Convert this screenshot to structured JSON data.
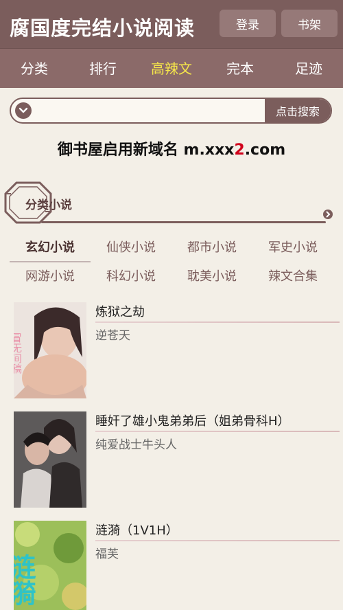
{
  "header": {
    "site_title": "腐国度完结小说阅读",
    "login_label": "登录",
    "bookshelf_label": "书架"
  },
  "nav": {
    "items": [
      "分类",
      "排行",
      "高辣文",
      "完本",
      "足迹"
    ],
    "active": "高辣文"
  },
  "search": {
    "value": "",
    "button_label": "点击搜索"
  },
  "notice": {
    "prefix": "御书屋启用新域名 m.xxx",
    "accent": "2",
    "suffix": ".com"
  },
  "section": {
    "title": "分类小说"
  },
  "categories": {
    "active": "玄幻小说",
    "items": [
      "玄幻小说",
      "仙侠小说",
      "都市小说",
      "军史小说",
      "网游小说",
      "科幻小说",
      "耽美小说",
      "辣文合集"
    ]
  },
  "books": [
    {
      "title": "炼狱之劫",
      "author": "逆苍天",
      "cover_text": "冒无间稿"
    },
    {
      "title": "睡奸了雄小鬼弟弟后（姐弟骨科H）",
      "author": "纯爱战士牛头人",
      "cover_text": ""
    },
    {
      "title": "涟漪（1V1H）",
      "author": "福芙",
      "cover_text": "涟漪"
    }
  ],
  "colors": {
    "header_bg": "#7b5d5c",
    "nav_bg": "#8b6a69",
    "nav_active": "#f5e64a",
    "accent_red": "#d0021b",
    "page_bg": "#f3efe7"
  }
}
